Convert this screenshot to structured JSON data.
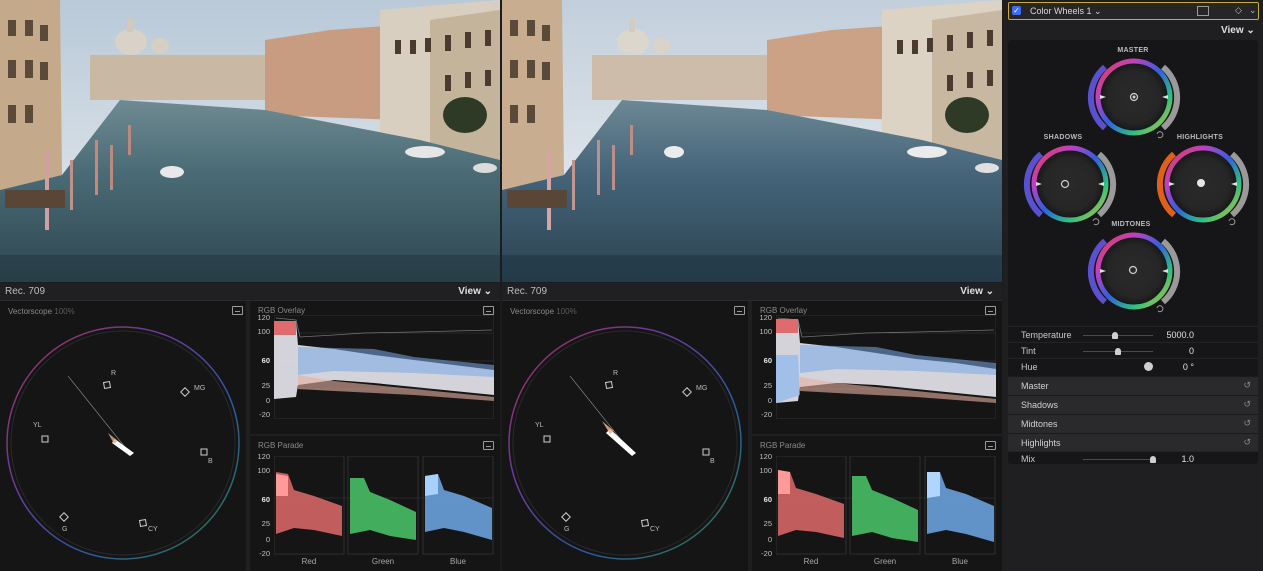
{
  "left": {
    "color_space": "Rec. 709",
    "view_label": "View ⌄",
    "vectorscope": {
      "title": "Vectorscope",
      "percent": "100%",
      "targets": [
        "R",
        "MG",
        "B",
        "CY",
        "G",
        "YL"
      ]
    },
    "rgb_overlay": {
      "title": "RGB Overlay",
      "ticks": [
        "120",
        "100",
        "60",
        "25",
        "0",
        "-20"
      ]
    },
    "rgb_parade": {
      "title": "RGB Parade",
      "ticks": [
        "120",
        "100",
        "60",
        "25",
        "0",
        "-20"
      ],
      "channels": [
        "Red",
        "Green",
        "Blue"
      ]
    }
  },
  "right": {
    "color_space": "Rec. 709",
    "view_label": "View ⌄",
    "vectorscope": {
      "title": "Vectorscope",
      "percent": "100%",
      "targets": [
        "R",
        "MG",
        "B",
        "CY",
        "G",
        "YL"
      ]
    },
    "rgb_overlay": {
      "title": "RGB Overlay",
      "ticks": [
        "120",
        "100",
        "60",
        "25",
        "0",
        "-20"
      ]
    },
    "rgb_parade": {
      "title": "RGB Parade",
      "ticks": [
        "120",
        "100",
        "60",
        "25",
        "0",
        "-20"
      ],
      "channels": [
        "Red",
        "Green",
        "Blue"
      ]
    }
  },
  "inspector": {
    "effect_name": "Color Wheels 1 ⌄",
    "view_label": "View ⌄",
    "wheels": {
      "master": "MASTER",
      "shadows": "SHADOWS",
      "highlights": "HIGHLIGHTS",
      "midtones": "MIDTONES"
    },
    "params": [
      {
        "label": "Temperature",
        "value": "5000.0",
        "level": 0.45
      },
      {
        "label": "Tint",
        "value": "0",
        "level": 0.5
      },
      {
        "label": "Hue",
        "value": "0 °"
      }
    ],
    "sections": [
      "Master",
      "Shadows",
      "Midtones",
      "Highlights"
    ],
    "mix": {
      "label": "Mix",
      "value": "1.0",
      "level": 1.0
    }
  }
}
